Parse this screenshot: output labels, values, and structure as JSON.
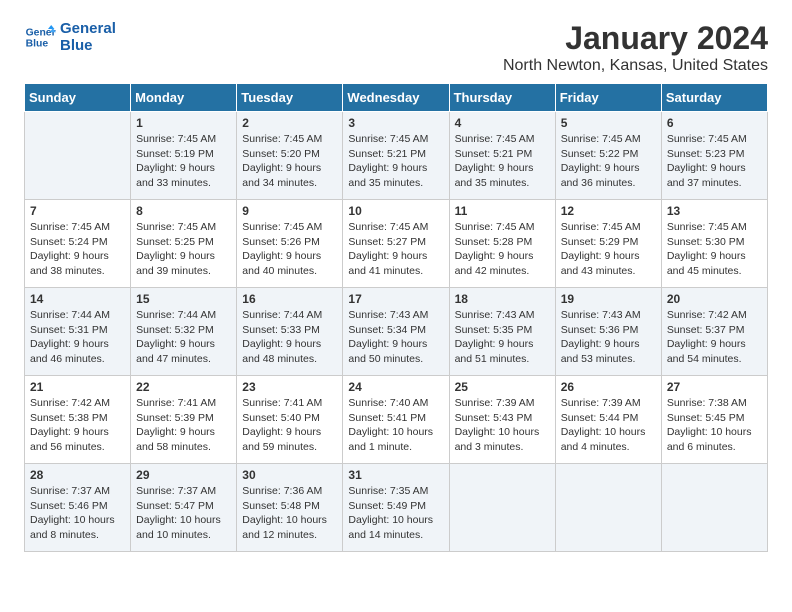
{
  "header": {
    "logo_line1": "General",
    "logo_line2": "Blue",
    "month": "January 2024",
    "location": "North Newton, Kansas, United States"
  },
  "days_of_week": [
    "Sunday",
    "Monday",
    "Tuesday",
    "Wednesday",
    "Thursday",
    "Friday",
    "Saturday"
  ],
  "weeks": [
    [
      {
        "day": "",
        "content": ""
      },
      {
        "day": "1",
        "content": "Sunrise: 7:45 AM\nSunset: 5:19 PM\nDaylight: 9 hours\nand 33 minutes."
      },
      {
        "day": "2",
        "content": "Sunrise: 7:45 AM\nSunset: 5:20 PM\nDaylight: 9 hours\nand 34 minutes."
      },
      {
        "day": "3",
        "content": "Sunrise: 7:45 AM\nSunset: 5:21 PM\nDaylight: 9 hours\nand 35 minutes."
      },
      {
        "day": "4",
        "content": "Sunrise: 7:45 AM\nSunset: 5:21 PM\nDaylight: 9 hours\nand 35 minutes."
      },
      {
        "day": "5",
        "content": "Sunrise: 7:45 AM\nSunset: 5:22 PM\nDaylight: 9 hours\nand 36 minutes."
      },
      {
        "day": "6",
        "content": "Sunrise: 7:45 AM\nSunset: 5:23 PM\nDaylight: 9 hours\nand 37 minutes."
      }
    ],
    [
      {
        "day": "7",
        "content": "Sunrise: 7:45 AM\nSunset: 5:24 PM\nDaylight: 9 hours\nand 38 minutes."
      },
      {
        "day": "8",
        "content": "Sunrise: 7:45 AM\nSunset: 5:25 PM\nDaylight: 9 hours\nand 39 minutes."
      },
      {
        "day": "9",
        "content": "Sunrise: 7:45 AM\nSunset: 5:26 PM\nDaylight: 9 hours\nand 40 minutes."
      },
      {
        "day": "10",
        "content": "Sunrise: 7:45 AM\nSunset: 5:27 PM\nDaylight: 9 hours\nand 41 minutes."
      },
      {
        "day": "11",
        "content": "Sunrise: 7:45 AM\nSunset: 5:28 PM\nDaylight: 9 hours\nand 42 minutes."
      },
      {
        "day": "12",
        "content": "Sunrise: 7:45 AM\nSunset: 5:29 PM\nDaylight: 9 hours\nand 43 minutes."
      },
      {
        "day": "13",
        "content": "Sunrise: 7:45 AM\nSunset: 5:30 PM\nDaylight: 9 hours\nand 45 minutes."
      }
    ],
    [
      {
        "day": "14",
        "content": "Sunrise: 7:44 AM\nSunset: 5:31 PM\nDaylight: 9 hours\nand 46 minutes."
      },
      {
        "day": "15",
        "content": "Sunrise: 7:44 AM\nSunset: 5:32 PM\nDaylight: 9 hours\nand 47 minutes."
      },
      {
        "day": "16",
        "content": "Sunrise: 7:44 AM\nSunset: 5:33 PM\nDaylight: 9 hours\nand 48 minutes."
      },
      {
        "day": "17",
        "content": "Sunrise: 7:43 AM\nSunset: 5:34 PM\nDaylight: 9 hours\nand 50 minutes."
      },
      {
        "day": "18",
        "content": "Sunrise: 7:43 AM\nSunset: 5:35 PM\nDaylight: 9 hours\nand 51 minutes."
      },
      {
        "day": "19",
        "content": "Sunrise: 7:43 AM\nSunset: 5:36 PM\nDaylight: 9 hours\nand 53 minutes."
      },
      {
        "day": "20",
        "content": "Sunrise: 7:42 AM\nSunset: 5:37 PM\nDaylight: 9 hours\nand 54 minutes."
      }
    ],
    [
      {
        "day": "21",
        "content": "Sunrise: 7:42 AM\nSunset: 5:38 PM\nDaylight: 9 hours\nand 56 minutes."
      },
      {
        "day": "22",
        "content": "Sunrise: 7:41 AM\nSunset: 5:39 PM\nDaylight: 9 hours\nand 58 minutes."
      },
      {
        "day": "23",
        "content": "Sunrise: 7:41 AM\nSunset: 5:40 PM\nDaylight: 9 hours\nand 59 minutes."
      },
      {
        "day": "24",
        "content": "Sunrise: 7:40 AM\nSunset: 5:41 PM\nDaylight: 10 hours\nand 1 minute."
      },
      {
        "day": "25",
        "content": "Sunrise: 7:39 AM\nSunset: 5:43 PM\nDaylight: 10 hours\nand 3 minutes."
      },
      {
        "day": "26",
        "content": "Sunrise: 7:39 AM\nSunset: 5:44 PM\nDaylight: 10 hours\nand 4 minutes."
      },
      {
        "day": "27",
        "content": "Sunrise: 7:38 AM\nSunset: 5:45 PM\nDaylight: 10 hours\nand 6 minutes."
      }
    ],
    [
      {
        "day": "28",
        "content": "Sunrise: 7:37 AM\nSunset: 5:46 PM\nDaylight: 10 hours\nand 8 minutes."
      },
      {
        "day": "29",
        "content": "Sunrise: 7:37 AM\nSunset: 5:47 PM\nDaylight: 10 hours\nand 10 minutes."
      },
      {
        "day": "30",
        "content": "Sunrise: 7:36 AM\nSunset: 5:48 PM\nDaylight: 10 hours\nand 12 minutes."
      },
      {
        "day": "31",
        "content": "Sunrise: 7:35 AM\nSunset: 5:49 PM\nDaylight: 10 hours\nand 14 minutes."
      },
      {
        "day": "",
        "content": ""
      },
      {
        "day": "",
        "content": ""
      },
      {
        "day": "",
        "content": ""
      }
    ]
  ]
}
